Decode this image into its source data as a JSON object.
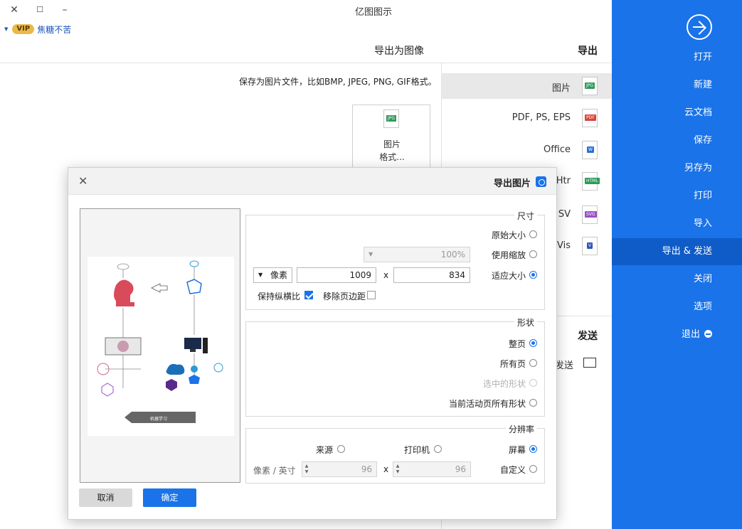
{
  "titlebar": {
    "app_title": "亿图图示",
    "close": "✕",
    "maximize": "☐",
    "minimize": "–"
  },
  "user": {
    "name": "焦糖不苦",
    "vip": "VIP"
  },
  "sidebar": {
    "items": [
      {
        "label": "打开"
      },
      {
        "label": "新建"
      },
      {
        "label": "云文档"
      },
      {
        "label": "保存"
      },
      {
        "label": "另存为"
      },
      {
        "label": "打印"
      },
      {
        "label": "导入"
      },
      {
        "label": "导出 & 发送"
      },
      {
        "label": "关闭"
      },
      {
        "label": "选项"
      },
      {
        "label": "退出"
      }
    ]
  },
  "export_panel": {
    "heading": "导出",
    "items": [
      {
        "label": "图片",
        "tag": "JPG"
      },
      {
        "label": "PDF, PS, EPS",
        "tag": "PDF"
      },
      {
        "label": "Office",
        "tag": "W"
      },
      {
        "label": "Htr",
        "tag": "HTML"
      },
      {
        "label": "SV",
        "tag": "SVG"
      },
      {
        "label": "Vis",
        "tag": "V"
      }
    ],
    "send_heading": "发送",
    "send_label": "发送"
  },
  "content": {
    "heading": "导出为图像",
    "description": "保存为图片文件，比如BMP, JPEG, PNG, GIF格式。",
    "tile_label_1": "图片",
    "tile_label_2": "格式...",
    "tile_tag": "JPG"
  },
  "dialog": {
    "title": "导出图片",
    "close": "✕",
    "size": {
      "title": "尺寸",
      "opt_original": "原始大小",
      "opt_zoom": "使用缩放",
      "zoom_value": "100%",
      "opt_fit": "适应大小",
      "width": "834",
      "x": "x",
      "height": "1009",
      "unit": "像素",
      "remove_margin": "移除页边距",
      "keep_ratio": "保持纵横比"
    },
    "shape": {
      "title": "形状",
      "opt_page": "整页",
      "opt_all": "所有页",
      "opt_selected": "选中的形状",
      "opt_current": "当前活动页所有形状"
    },
    "resolution": {
      "title": "分辨率",
      "opt_screen": "屏幕",
      "opt_printer": "打印机",
      "opt_source": "来源",
      "opt_custom": "自定义",
      "dpi_x": "96",
      "x": "x",
      "dpi_y": "96",
      "unit": "像素 / 英寸"
    },
    "ok": "确定",
    "cancel": "取消",
    "preview_banner": "机器学习"
  }
}
